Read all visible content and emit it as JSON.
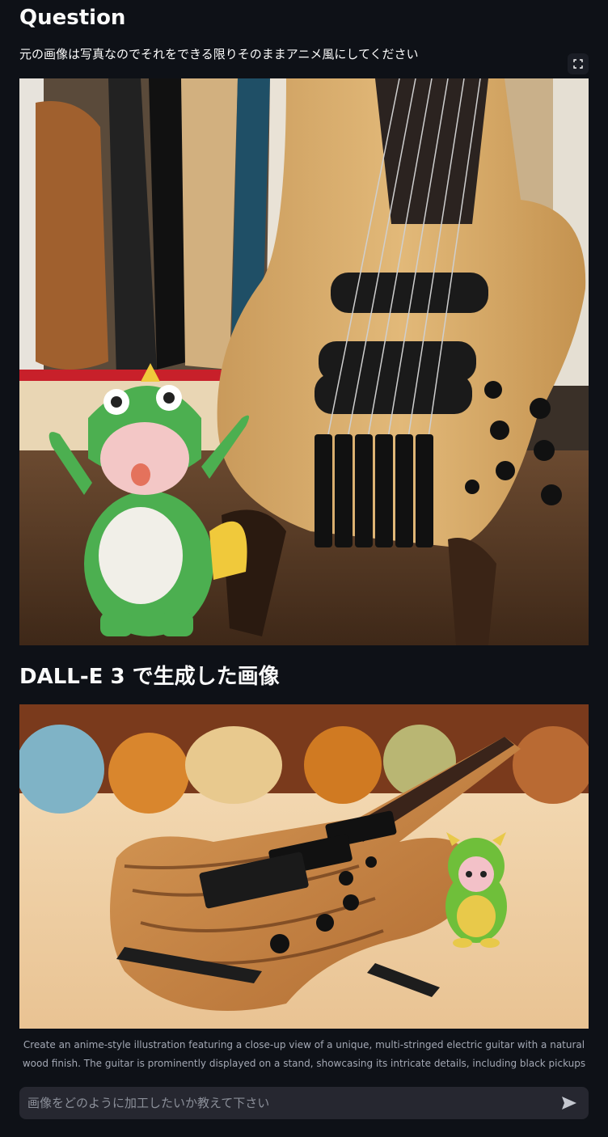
{
  "question_section": {
    "heading": "Question",
    "prompt_text": "元の画像は写真なのでそれをできる限りそのままアニメ風にしてください",
    "image_description": "Photo of a natural wood multi-string bass guitar on a stand with a green dinosaur-hood figurine",
    "fullscreen_icon": "expand-icon"
  },
  "generated_section": {
    "heading": "DALL-E 3 で生成した画像",
    "caption": "Create an anime-style illustration featuring a close-up view of a unique, multi-stringed electric guitar with a natural wood finish. The guitar is prominently displayed on a stand, showcasing its intricate details, including black pickups and"
  },
  "chat_input": {
    "placeholder": "画像をどのように加工したいか教えて下さい",
    "value": "",
    "send_icon": "send-icon"
  },
  "colors": {
    "background": "#0e1117",
    "input_background": "#262730",
    "text": "#fafafa",
    "caption_text": "#a3a8b4"
  }
}
